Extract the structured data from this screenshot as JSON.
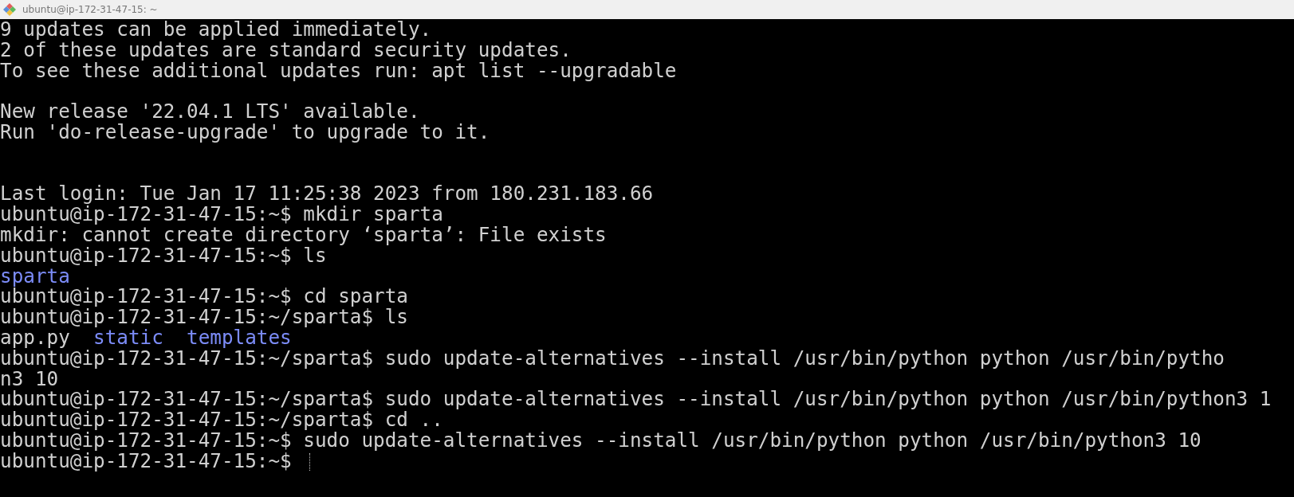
{
  "window": {
    "title": "ubuntu@ip-172-31-47-15: ~"
  },
  "terminal": {
    "lines": [
      {
        "kind": "text",
        "segments": [
          {
            "text": "9 updates can be applied immediately.",
            "kind": "plain"
          }
        ]
      },
      {
        "kind": "text",
        "segments": [
          {
            "text": "2 of these updates are standard security updates.",
            "kind": "plain"
          }
        ]
      },
      {
        "kind": "text",
        "segments": [
          {
            "text": "To see these additional updates run: apt list --upgradable",
            "kind": "plain"
          }
        ]
      },
      {
        "kind": "blank"
      },
      {
        "kind": "text",
        "segments": [
          {
            "text": "New release '22.04.1 LTS' available.",
            "kind": "plain"
          }
        ]
      },
      {
        "kind": "text",
        "segments": [
          {
            "text": "Run 'do-release-upgrade' to upgrade to it.",
            "kind": "plain"
          }
        ]
      },
      {
        "kind": "blank"
      },
      {
        "kind": "blank"
      },
      {
        "kind": "text",
        "segments": [
          {
            "text": "Last login: Tue Jan 17 11:25:38 2023 from 180.231.183.66",
            "kind": "plain"
          }
        ]
      },
      {
        "kind": "text",
        "segments": [
          {
            "text": "ubuntu@ip-172-31-47-15:~$ mkdir sparta",
            "kind": "plain"
          }
        ]
      },
      {
        "kind": "text",
        "segments": [
          {
            "text": "mkdir: cannot create directory ‘sparta’: File exists",
            "kind": "plain"
          }
        ]
      },
      {
        "kind": "text",
        "segments": [
          {
            "text": "ubuntu@ip-172-31-47-15:~$ ls",
            "kind": "plain"
          }
        ]
      },
      {
        "kind": "text",
        "segments": [
          {
            "text": "sparta",
            "kind": "dir"
          }
        ]
      },
      {
        "kind": "text",
        "segments": [
          {
            "text": "ubuntu@ip-172-31-47-15:~$ cd sparta",
            "kind": "plain"
          }
        ]
      },
      {
        "kind": "text",
        "segments": [
          {
            "text": "ubuntu@ip-172-31-47-15:~/sparta$ ls",
            "kind": "plain"
          }
        ]
      },
      {
        "kind": "text",
        "segments": [
          {
            "text": "app.py",
            "kind": "plain"
          },
          {
            "text": "static",
            "kind": "dir"
          },
          {
            "text": "templates",
            "kind": "dir"
          }
        ]
      },
      {
        "kind": "text",
        "segments": [
          {
            "text": "ubuntu@ip-172-31-47-15:~/sparta$ sudo update-alternatives --install /usr/bin/python python /usr/bin/pytho",
            "kind": "plain"
          }
        ]
      },
      {
        "kind": "text",
        "segments": [
          {
            "text": "n3 10",
            "kind": "plain"
          }
        ]
      },
      {
        "kind": "text",
        "segments": [
          {
            "text": "ubuntu@ip-172-31-47-15:~/sparta$ sudo update-alternatives --install /usr/bin/python python /usr/bin/python3 1",
            "kind": "plain"
          }
        ]
      },
      {
        "kind": "text",
        "segments": [
          {
            "text": "ubuntu@ip-172-31-47-15:~/sparta$ cd ..",
            "kind": "plain"
          }
        ]
      },
      {
        "kind": "text",
        "segments": [
          {
            "text": "ubuntu@ip-172-31-47-15:~$ sudo update-alternatives --install /usr/bin/python python /usr/bin/python3 10",
            "kind": "plain"
          }
        ]
      },
      {
        "kind": "prompt",
        "segments": [
          {
            "text": "ubuntu@ip-172-31-47-15:~$",
            "kind": "plain"
          }
        ]
      }
    ]
  }
}
